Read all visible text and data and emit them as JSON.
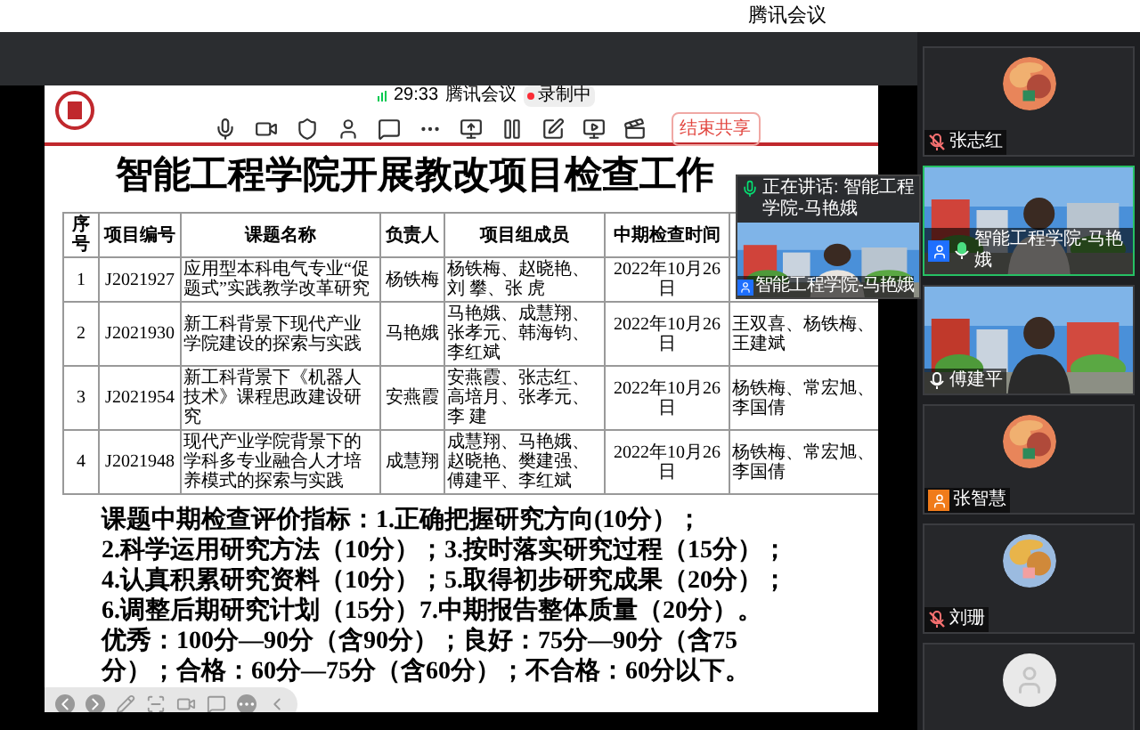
{
  "app_title": "腾讯会议",
  "share_toolbar": {
    "timer": "29:33",
    "title": "腾讯会议",
    "recording": "录制中",
    "end_button": "结束共享"
  },
  "slide": {
    "title": "智能工程学院开展教改项目检查工作",
    "table": {
      "columns": [
        "序号",
        "项目编号",
        "课题名称",
        "负责人",
        "项目组成员",
        "中期检查时间"
      ],
      "rows": [
        {
          "cells": [
            "1",
            "J2021927",
            "应用型本科电气专业“促题式”实践教学改革研究",
            "杨铁梅",
            "杨铁梅、赵晓艳、刘 攀、张 虎",
            "2022年10月26日"
          ]
        },
        {
          "cells": [
            "2",
            "J2021930",
            "新工科背景下现代产业学院建设的探索与实践",
            "马艳娥",
            "马艳娥、成慧翔、张孝元、韩海钧、李红斌",
            "2022年10月26日",
            "王双喜、杨铁梅、王建斌"
          ]
        },
        {
          "cells": [
            "3",
            "J2021954",
            "新工科背景下《机器人技术》课程思政建设研究",
            "安燕霞",
            "安燕霞、张志红、高培月、张孝元、李 建",
            "2022年10月26日",
            "杨铁梅、常宏旭、李国倩"
          ]
        },
        {
          "cells": [
            "4",
            "J2021948",
            "现代产业学院背景下的学科多专业融合人才培养模式的探索与实践",
            "成慧翔",
            "成慧翔、马艳娥、赵晓艳、樊建强、傅建平、李红斌",
            "2022年10月26日",
            "杨铁梅、常宏旭、李国倩"
          ]
        }
      ]
    },
    "criteria": [
      "课题中期检查评价指标：1.正确把握研究方向(10分）；",
      "2.科学运用研究方法（10分）；3.按时落实研究过程（15分）；",
      "4.认真积累研究资料（10分）；5.取得初步研究成果（20分）；",
      "6.调整后期研究计划（15分）7.中期报告整体质量（20分）。",
      "优秀：100分—90分（含90分）；良好：75分—90分（含75",
      "分）；合格：60分—75分（含60分）；不合格：60分以下。"
    ]
  },
  "speaker_overlay": {
    "speaking": "正在讲话: 智能工程学院-马艳娥",
    "name": "智能工程学院-马艳娥"
  },
  "participants": [
    {
      "name": "张志红",
      "kind": "photo-avatar",
      "mic": {
        "muted": true,
        "speaking": false
      },
      "selected": false
    },
    {
      "name": "智能工程学院-马艳娥",
      "kind": "video",
      "mic": {
        "muted": false,
        "speaking": true
      },
      "role_badge": {
        "color": "#1e6fff"
      },
      "selected": true
    },
    {
      "name": "傅建平",
      "kind": "video",
      "mic": {
        "muted": false,
        "speaking": false
      },
      "selected": false
    },
    {
      "name": "张智慧",
      "kind": "photo-avatar",
      "role_badge": {
        "color": "#f07b1a"
      },
      "selected": false
    },
    {
      "name": "刘珊",
      "kind": "photo-avatar",
      "mic": {
        "muted": true,
        "speaking": false
      },
      "selected": false
    },
    {
      "kind": "default-avatar",
      "selected": false
    }
  ]
}
